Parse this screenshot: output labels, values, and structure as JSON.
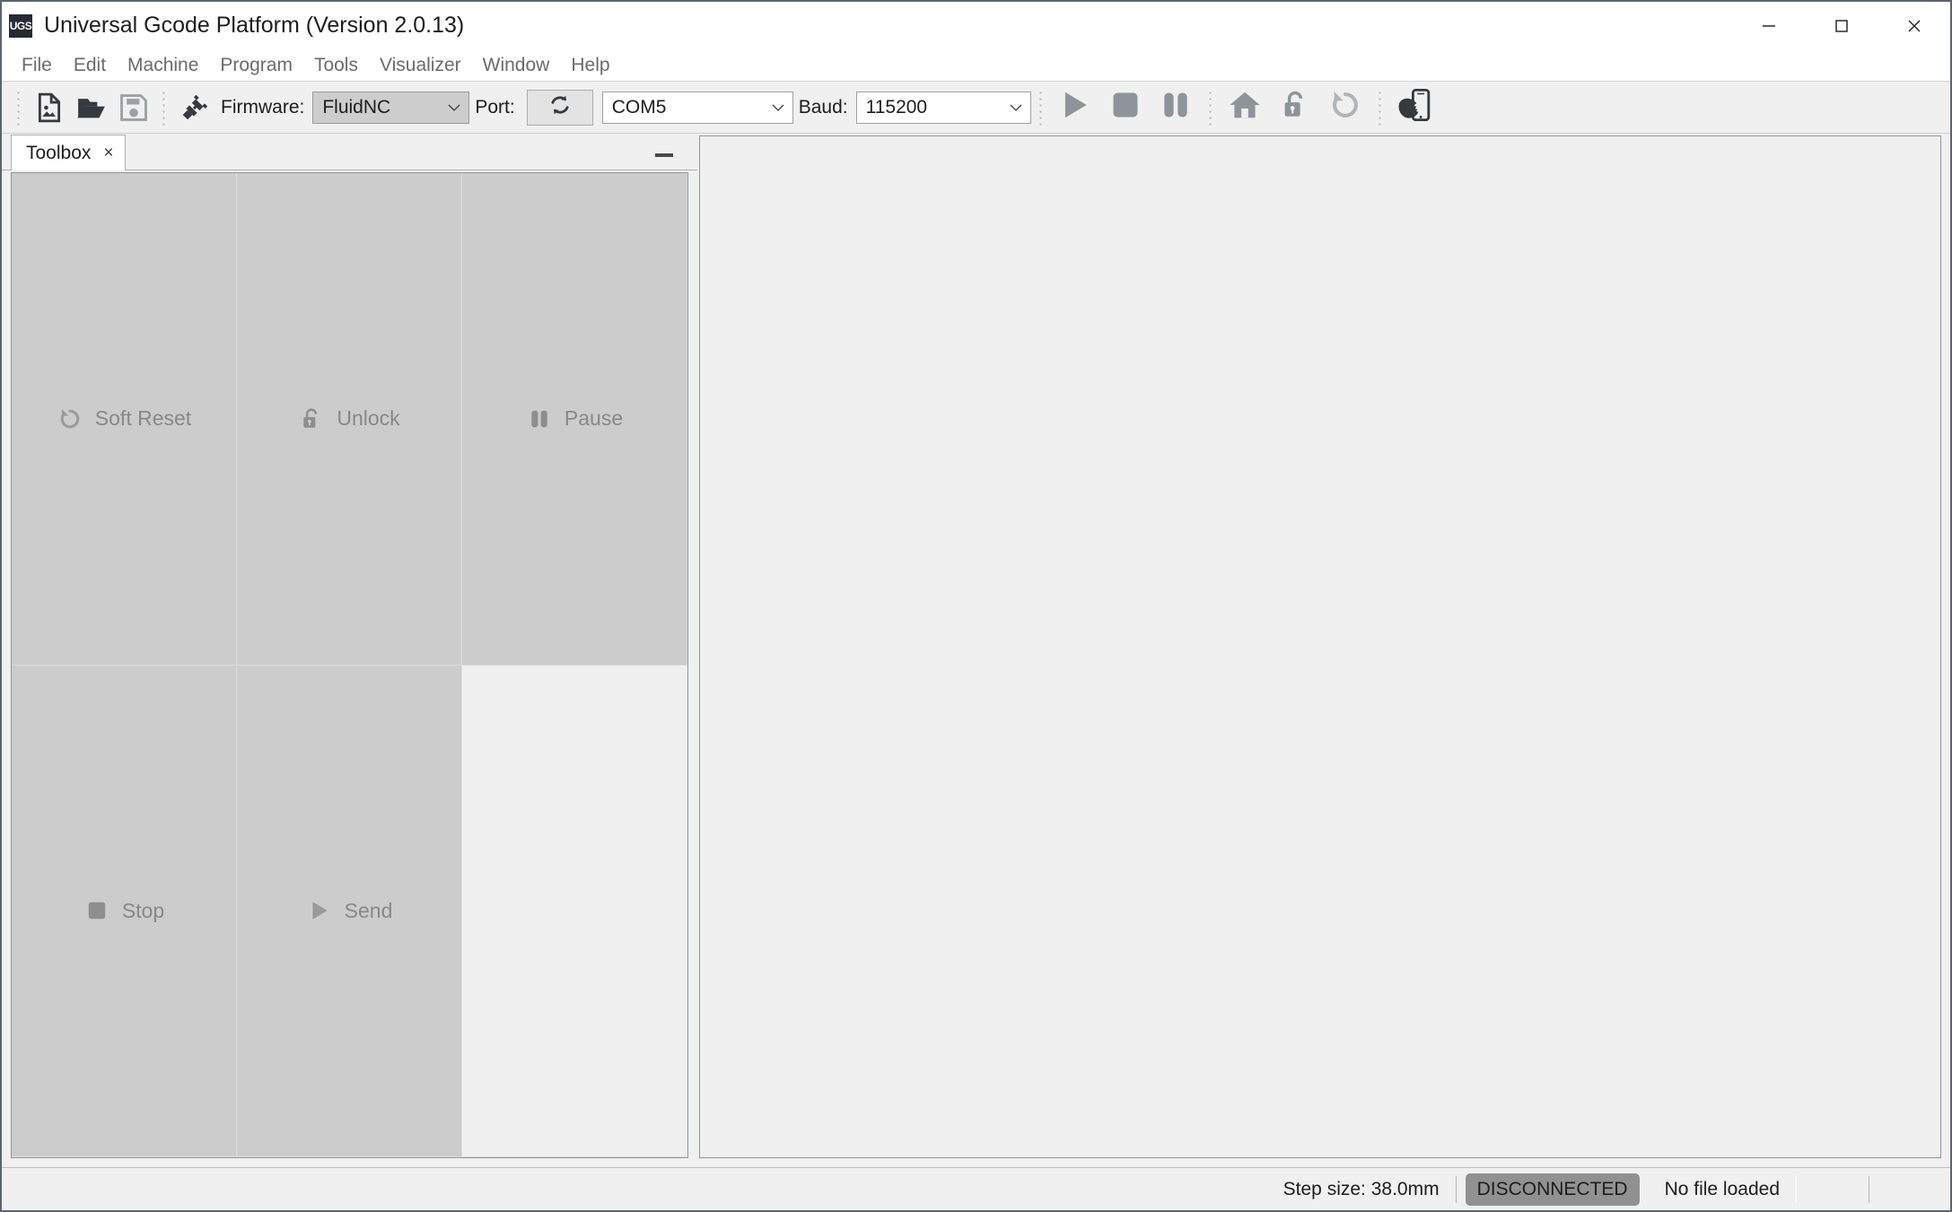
{
  "window": {
    "logo_text": "UGS",
    "title": "Universal Gcode Platform (Version 2.0.13)",
    "controls": {
      "minimize": "minimize-icon",
      "maximize": "maximize-icon",
      "close": "close-icon"
    }
  },
  "menubar": {
    "items": [
      {
        "label": "File"
      },
      {
        "label": "Edit"
      },
      {
        "label": "Machine"
      },
      {
        "label": "Program"
      },
      {
        "label": "Tools"
      },
      {
        "label": "Visualizer"
      },
      {
        "label": "Window"
      },
      {
        "label": "Help"
      }
    ]
  },
  "toolbar": {
    "file_icons": [
      {
        "name": "new-file-icon"
      },
      {
        "name": "open-file-icon"
      },
      {
        "name": "save-file-icon"
      }
    ],
    "connect_icon": "connect-plug-icon",
    "firmware_label": "Firmware:",
    "firmware_value": "FluidNC",
    "port_label": "Port:",
    "port_refresh_icon": "refresh-icon",
    "port_value": "COM5",
    "baud_label": "Baud:",
    "baud_value": "115200",
    "machine_icons": [
      {
        "name": "play-icon"
      },
      {
        "name": "stop-icon"
      },
      {
        "name": "pause-icon"
      }
    ],
    "home_icons": [
      {
        "name": "home-icon"
      },
      {
        "name": "unlock-icon"
      },
      {
        "name": "soft-reset-icon"
      }
    ],
    "pendant_icon": "pendant-device-icon"
  },
  "left_panel": {
    "tab": {
      "label": "Toolbox",
      "close_glyph": "×"
    },
    "minimize_glyph": "—",
    "buttons": [
      {
        "label": "Soft Reset",
        "icon": "soft-reset-icon"
      },
      {
        "label": "Unlock",
        "icon": "unlock-icon"
      },
      {
        "label": "Pause",
        "icon": "pause-icon"
      },
      {
        "label": "Stop",
        "icon": "stop-icon"
      },
      {
        "label": "Send",
        "icon": "play-icon"
      }
    ]
  },
  "statusbar": {
    "step_size": "Step size: 38.0mm",
    "connection_status": "DISCONNECTED",
    "file_status": "No file loaded"
  },
  "colors": {
    "accent_dark": "#343a40",
    "icon_grey": "#8e9499",
    "badge_grey": "#919191",
    "panel_grey": "#cccccc",
    "background": "#f0f0f0"
  }
}
